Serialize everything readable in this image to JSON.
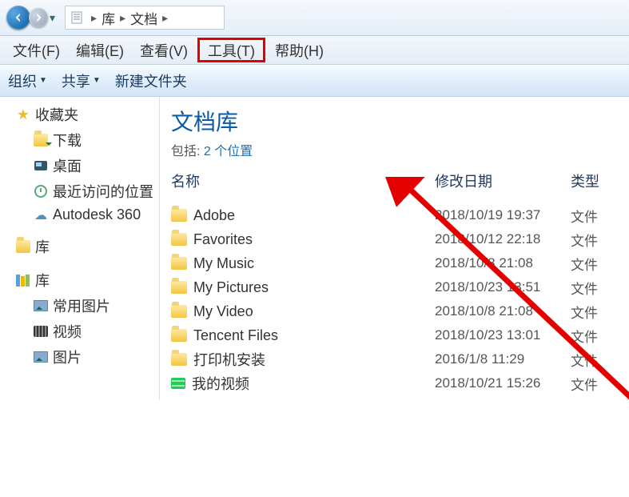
{
  "nav": {
    "breadcrumb": [
      "库",
      "文档"
    ]
  },
  "menu": {
    "file": "文件(F)",
    "edit": "编辑(E)",
    "view": "查看(V)",
    "tools": "工具(T)",
    "help": "帮助(H)"
  },
  "toolbar": {
    "organize": "组织",
    "share": "共享",
    "newfolder": "新建文件夹"
  },
  "sidebar": {
    "favorites": {
      "label": "收藏夹",
      "children": [
        {
          "icon": "download",
          "label": "下载"
        },
        {
          "icon": "desktop",
          "label": "桌面"
        },
        {
          "icon": "recent",
          "label": "最近访问的位置"
        },
        {
          "icon": "cloud",
          "label": "Autodesk 360"
        }
      ]
    },
    "libraries_short": {
      "label": "库"
    },
    "libraries": {
      "label": "库",
      "children": [
        {
          "icon": "pictures",
          "label": "常用图片"
        },
        {
          "icon": "videos",
          "label": "视频"
        },
        {
          "icon": "pictures",
          "label": "图片"
        }
      ]
    }
  },
  "content": {
    "title": "文档库",
    "subtitle_prefix": "包括: ",
    "subtitle_locations": "2 个位置",
    "columns": {
      "name": "名称",
      "date": "修改日期",
      "type": "类型"
    },
    "type_folder": "文件",
    "rows": [
      {
        "name": "Adobe",
        "date": "2018/10/19 19:37",
        "type_key": "type_folder",
        "icon": "folder"
      },
      {
        "name": "Favorites",
        "date": "2018/10/12 22:18",
        "type_key": "type_folder",
        "icon": "folder"
      },
      {
        "name": "My Music",
        "date": "2018/10/8 21:08",
        "type_key": "type_folder",
        "icon": "folder"
      },
      {
        "name": "My Pictures",
        "date": "2018/10/23 13:51",
        "type_key": "type_folder",
        "icon": "folder"
      },
      {
        "name": "My Video",
        "date": "2018/10/8 21:08",
        "type_key": "type_folder",
        "icon": "folder"
      },
      {
        "name": "Tencent Files",
        "date": "2018/10/23 13:01",
        "type_key": "type_folder",
        "icon": "folder"
      },
      {
        "name": "打印机安装",
        "date": "2016/1/8 11:29",
        "type_key": "type_folder",
        "icon": "folder"
      },
      {
        "name": "我的视频",
        "date": "2018/10/21 15:26",
        "type_key": "type_folder",
        "icon": "video"
      }
    ]
  }
}
